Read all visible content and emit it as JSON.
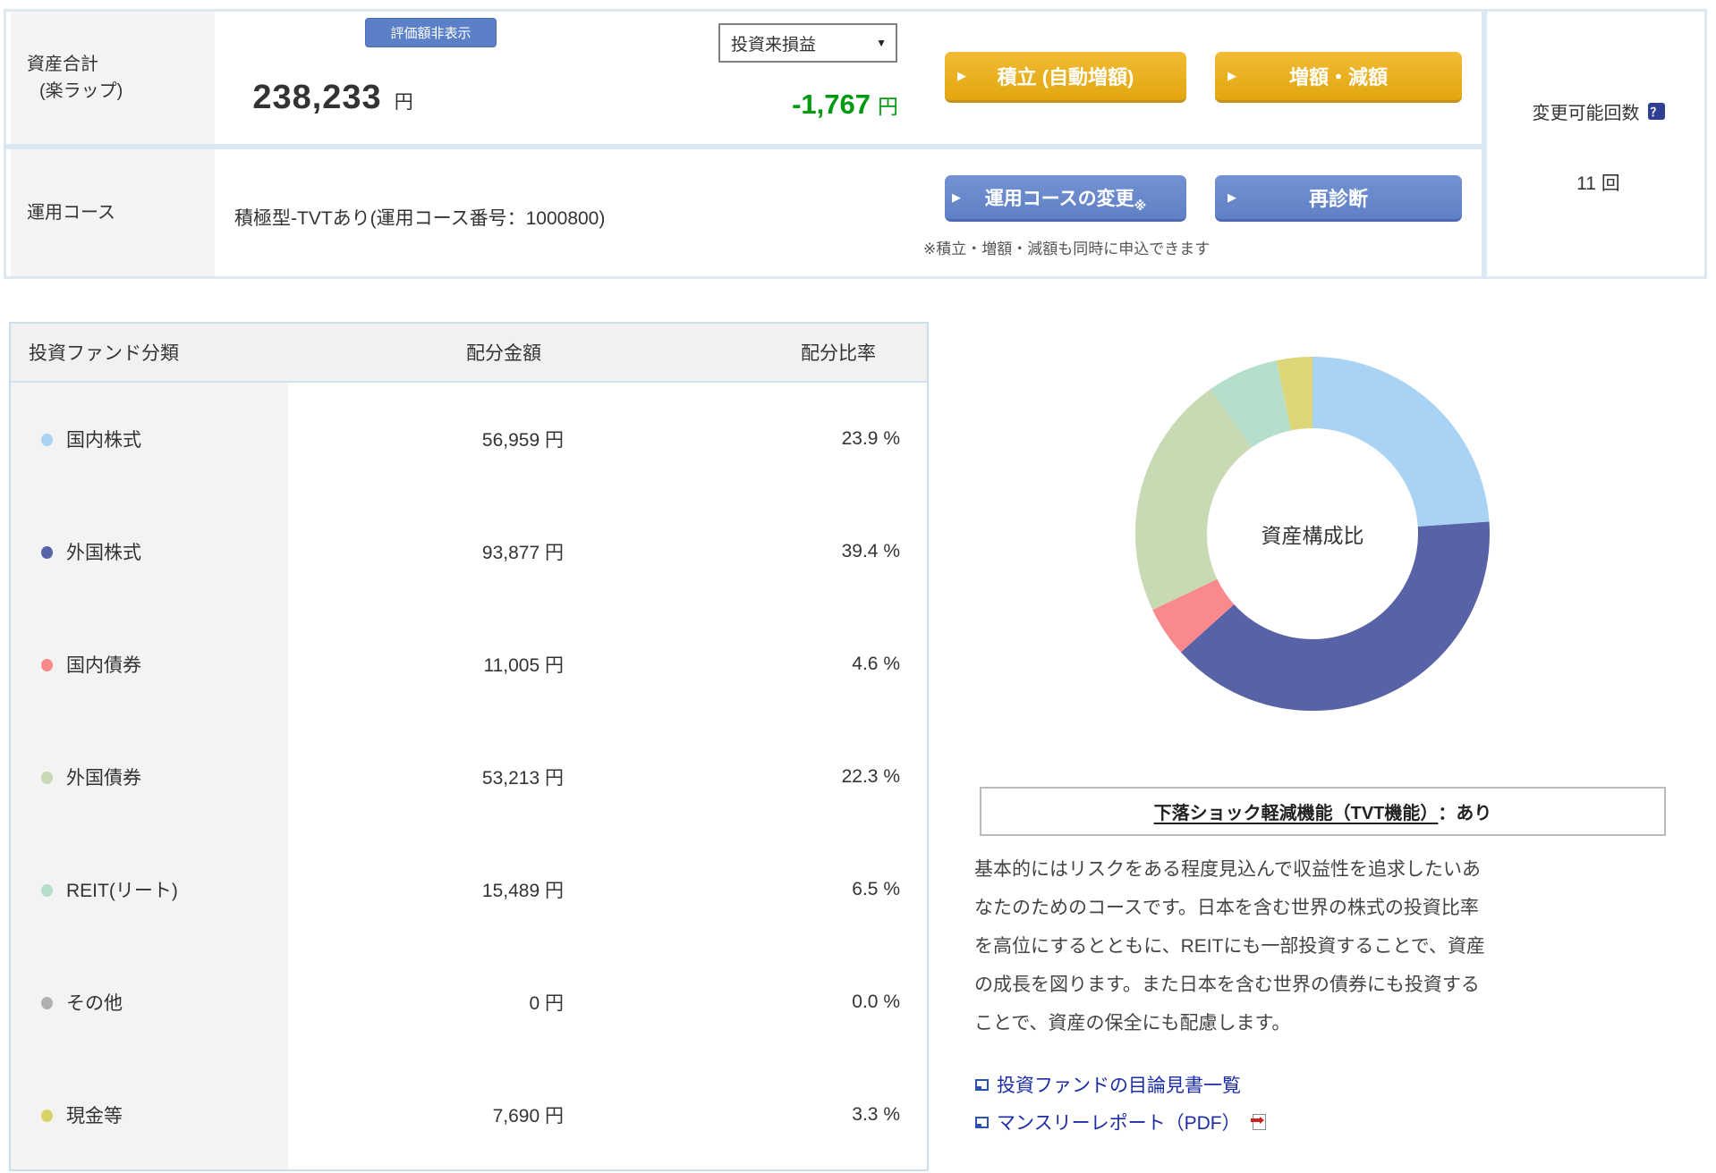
{
  "header": {
    "asset_total": {
      "label_line1": "資産合計",
      "label_line2": "(楽ラップ)",
      "hide_button": "評価額非表示",
      "amount": "238,233",
      "amount_unit": "円",
      "period_select_value": "投資来損益",
      "select_arrow": "▼",
      "pl_value": "-1,767",
      "pl_unit": "円",
      "pl_color": "#009a0e"
    },
    "course": {
      "label": "運用コース",
      "value": "積極型-TVTあり(運用コース番号：1000800)"
    },
    "buttons": {
      "arrow": "▶",
      "tsumitate": "積立 (自動増額)",
      "zougaku": "増額・減額",
      "course_change": "運用コースの変更",
      "course_change_mark": "※",
      "rediagnosis": "再診断"
    },
    "apply_note": "※積立・増額・減額も同時に申込できます",
    "change_count": {
      "label": "変更可能回数",
      "help_icon": "？",
      "value": "11 回"
    },
    "accent_colors": {
      "orange_button": "#e8ab18",
      "blue_button": "#6b8ccc",
      "hide_button_blue": "#5b80c8",
      "help_navy": "#2e3f94"
    }
  },
  "table": {
    "headers": [
      "投資ファンド分類",
      "配分金額",
      "配分比率"
    ],
    "rows": [
      {
        "label": "国内株式",
        "amount": "56,959 円",
        "ratio": "23.9 %",
        "color": "#a9d3f5"
      },
      {
        "label": "外国株式",
        "amount": "93,877 円",
        "ratio": "39.4 %",
        "color": "#5763a6"
      },
      {
        "label": "国内債券",
        "amount": "11,005 円",
        "ratio": "4.6 %",
        "color": "#f9898c"
      },
      {
        "label": "外国債券",
        "amount": "53,213 円",
        "ratio": "22.3 %",
        "color": "#c8dab4"
      },
      {
        "label": "REIT(リート)",
        "amount": "15,489 円",
        "ratio": "6.5 %",
        "color": "#b5dfcb"
      },
      {
        "label": "その他",
        "amount": "0 円",
        "ratio": "0.0 %",
        "color": "#b0b0b0"
      },
      {
        "label": "現金等",
        "amount": "7,690 円",
        "ratio": "3.3 %",
        "color": "#d9d468"
      }
    ]
  },
  "chart_data": {
    "type": "pie",
    "subtype": "donut",
    "title_center": "資産構成比",
    "categories": [
      "国内株式",
      "外国株式",
      "国内債券",
      "外国債券",
      "REIT(リート)",
      "その他",
      "現金等"
    ],
    "values_percent": [
      23.9,
      39.4,
      4.6,
      22.3,
      6.5,
      0.0,
      3.3
    ],
    "values_yen": [
      56959,
      93877,
      11005,
      53213,
      15489,
      0,
      7690
    ],
    "colors": [
      "#a9d3f5",
      "#5763a6",
      "#f9898c",
      "#c8dab4",
      "#b5dfcb",
      "#b0b0b0",
      "#ddd77a"
    ],
    "start_angle_deg": 0,
    "direction": "clockwise",
    "inner_radius_ratio": 0.6,
    "legend_position": "none"
  },
  "tvt": {
    "title_underline": "下落ショック軽減機能（TVT機能）",
    "title_rest": "：あり"
  },
  "description": {
    "lines": [
      "基本的にはリスクをある程度見込んで収益性を追求したいあ",
      "なたのためのコースです。日本を含む世界の株式の投資比率",
      "を高位にするとともに、REITにも一部投資することで、資産",
      "の成長を図ります。また日本を含む世界の債券にも投資する",
      "ことで、資産の保全にも配慮します。"
    ]
  },
  "links": {
    "prospectus": "投資ファンドの目論見書一覧",
    "monthly_report": "マンスリーレポート（PDF）"
  }
}
